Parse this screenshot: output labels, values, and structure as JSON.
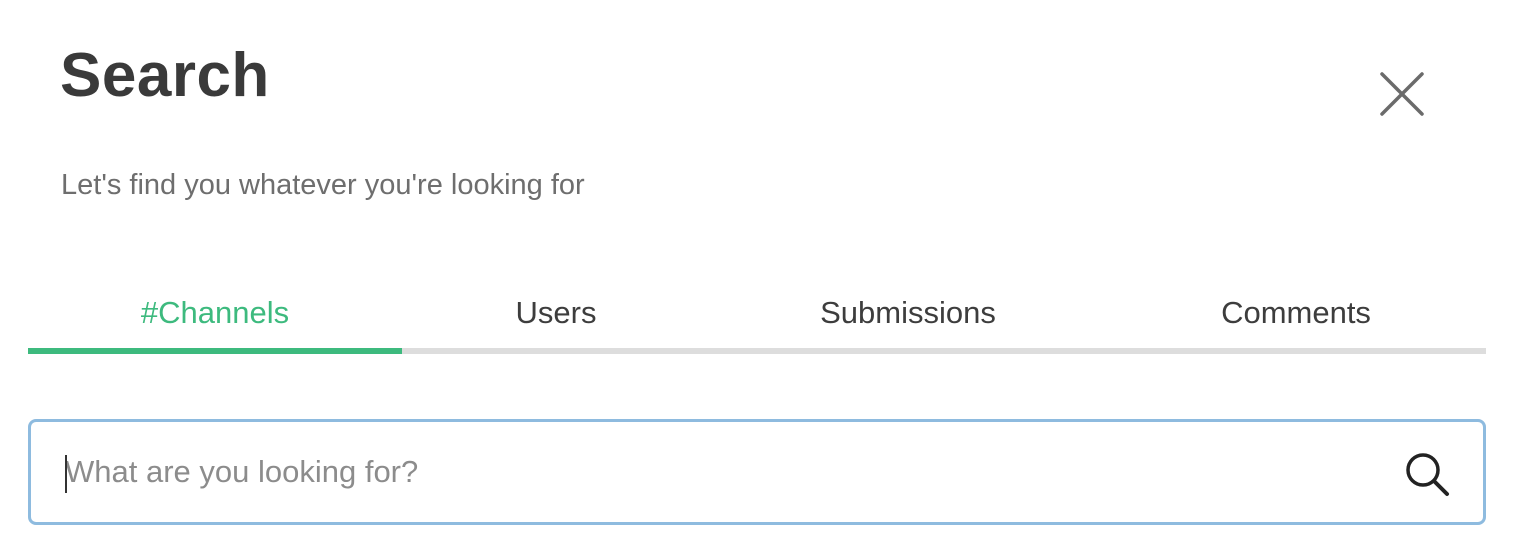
{
  "header": {
    "title": "Search",
    "subtitle": "Let's find you whatever you're looking for",
    "close_icon": "close-icon"
  },
  "tabs": [
    {
      "label": "#Channels",
      "active": true
    },
    {
      "label": "Users",
      "active": false
    },
    {
      "label": "Submissions",
      "active": false
    },
    {
      "label": "Comments",
      "active": false
    }
  ],
  "search": {
    "value": "",
    "placeholder": "What are you looking for?",
    "icon": "search-icon"
  },
  "colors": {
    "accent": "#3dba7e",
    "input_border": "#8ebbdf",
    "tab_track": "#dddddd",
    "title_text": "#3a3a3a"
  }
}
